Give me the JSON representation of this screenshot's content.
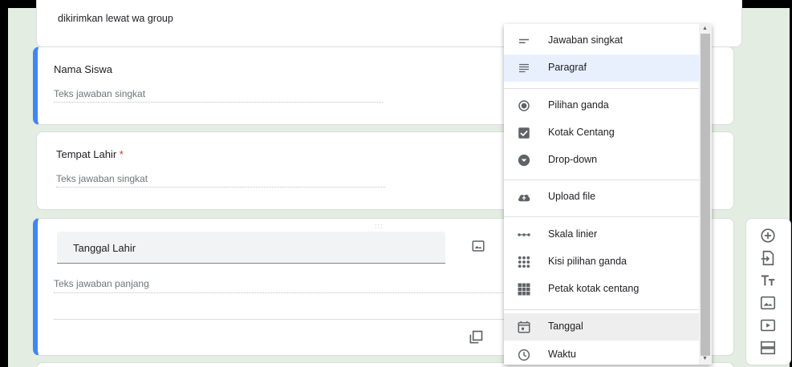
{
  "form": {
    "top_card_text": "dikirimkan lewat wa group",
    "questions": [
      {
        "title": "Nama Siswa",
        "hint": "Teks jawaban singkat",
        "required": false
      },
      {
        "title": "Tempat Lahir",
        "required_mark": "*",
        "hint": "Teks jawaban singkat",
        "required": true
      },
      {
        "title": "Tanggal Lahir",
        "hint": "Teks jawaban panjang",
        "drag_handle": ":::"
      }
    ]
  },
  "type_menu": {
    "items": [
      {
        "label": "Jawaban singkat",
        "icon": "short-answer-icon"
      },
      {
        "label": "Paragraf",
        "icon": "paragraph-icon",
        "state": "highlighted"
      },
      {
        "label": "Pilihan ganda",
        "icon": "radio-icon"
      },
      {
        "label": "Kotak Centang",
        "icon": "checkbox-icon"
      },
      {
        "label": "Drop-down",
        "icon": "dropdown-icon"
      },
      {
        "label": "Upload file",
        "icon": "cloud-upload-icon"
      },
      {
        "label": "Skala linier",
        "icon": "linear-scale-icon"
      },
      {
        "label": "Kisi pilihan ganda",
        "icon": "grid-radio-icon"
      },
      {
        "label": "Petak kotak centang",
        "icon": "grid-checkbox-icon"
      },
      {
        "label": "Tanggal",
        "icon": "calendar-icon",
        "state": "hover"
      },
      {
        "label": "Waktu",
        "icon": "clock-icon"
      }
    ]
  },
  "toolbar": {
    "items": [
      "add-question-icon",
      "import-questions-icon",
      "add-title-icon",
      "add-image-icon",
      "add-video-icon",
      "add-section-icon"
    ]
  },
  "colors": {
    "accent": "#4285f4",
    "background": "#e3ede1",
    "highlight": "#e8f0fe",
    "required": "#d93025"
  }
}
